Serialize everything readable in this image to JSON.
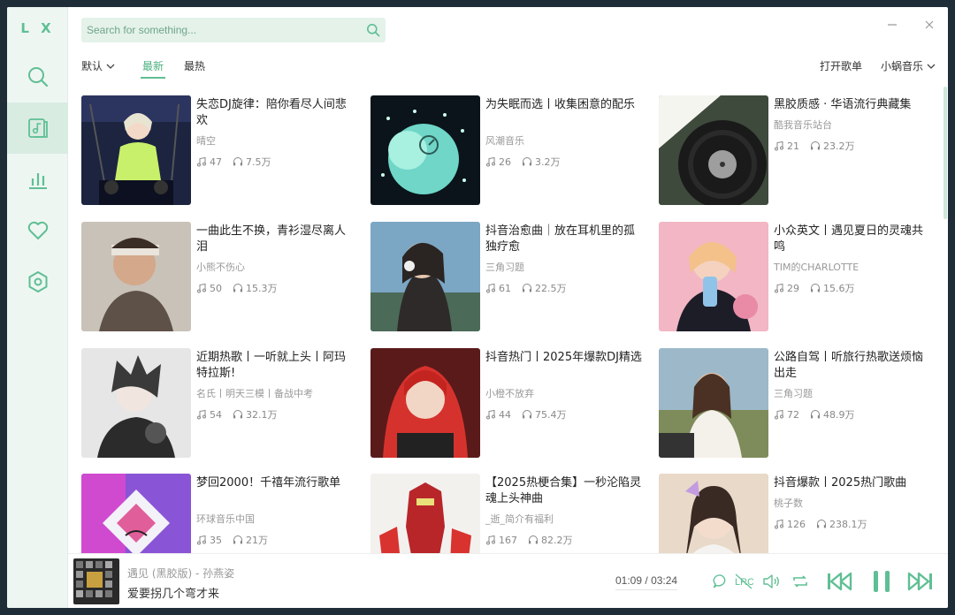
{
  "app": {
    "logo": "L X"
  },
  "search": {
    "placeholder": "Search for something..."
  },
  "filters": {
    "sort": "默认",
    "latest": "最新",
    "hottest": "最热"
  },
  "top_right": {
    "open_list": "打开歌单",
    "source": "小蜗音乐"
  },
  "colors": {
    "accent": "#5fbf94",
    "accent_dark": "#4caf7e",
    "sidebar_bg": "#eef6f2"
  },
  "sidebar": {
    "items": [
      {
        "name": "search-icon"
      },
      {
        "name": "music-list-icon"
      },
      {
        "name": "chart-icon"
      },
      {
        "name": "heart-icon"
      },
      {
        "name": "settings-icon"
      }
    ]
  },
  "cards": [
    {
      "title": "失恋DJ旋律：陪你看尽人间悲欢",
      "author": "晴空",
      "songs": "47",
      "plays": "7.5万"
    },
    {
      "title": "为失眠而选丨收集困意的配乐",
      "author": "风潮音乐",
      "songs": "26",
      "plays": "3.2万"
    },
    {
      "title": "黑胶质感 · 华语流行典藏集",
      "author": "酷我音乐站台",
      "songs": "21",
      "plays": "23.2万"
    },
    {
      "title": "一曲此生不换，青衫湿尽离人泪",
      "author": "小熊不伤心",
      "songs": "50",
      "plays": "15.3万"
    },
    {
      "title": "抖音治愈曲｜放在耳机里的孤独疗愈",
      "author": "三角习题",
      "songs": "61",
      "plays": "22.5万"
    },
    {
      "title": "小众英文丨遇见夏日的灵魂共鸣",
      "author": "TIM的CHARLOTTE",
      "songs": "29",
      "plays": "15.6万"
    },
    {
      "title": "近期热歌丨一听就上头丨阿玛特拉斯!",
      "author": "名氏丨明天三模丨备战中考",
      "songs": "54",
      "plays": "32.1万"
    },
    {
      "title": "抖音热门丨2025年爆款DJ精选",
      "author": "小橙不放弃",
      "songs": "44",
      "plays": "75.4万"
    },
    {
      "title": "公路自驾丨听旅行热歌送烦恼出走",
      "author": "三角习题",
      "songs": "72",
      "plays": "48.9万"
    },
    {
      "title": "梦回2000！千禧年流行歌单",
      "author": "环球音乐中国",
      "songs": "35",
      "plays": "21万"
    },
    {
      "title": "【2025热梗合集】一秒沦陷灵魂上头神曲",
      "author": "_逝_简介有福利",
      "songs": "167",
      "plays": "82.2万"
    },
    {
      "title": "抖音爆款丨2025热门歌曲",
      "author": "桃子数",
      "songs": "126",
      "plays": "238.1万"
    }
  ],
  "player": {
    "title": "遇见 (黑胶版) - 孙燕姿",
    "lyric": "爱要拐几个弯才来",
    "current": "01:09",
    "sep": "/",
    "total": "03:24"
  }
}
